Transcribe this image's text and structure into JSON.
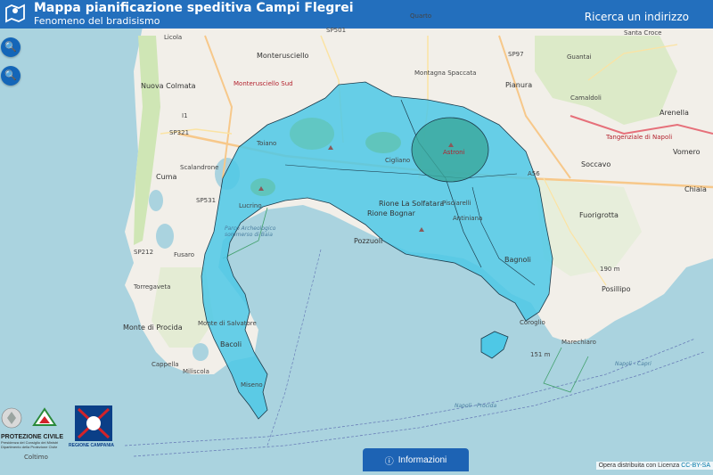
{
  "header": {
    "title": "Mappa pianificazione speditiva Campi Flegrei",
    "subtitle": "Fenomeno del bradisismo",
    "search_label": "Ricerca un indirizzo"
  },
  "colors": {
    "header_bg": "#1866ba",
    "zone_fill": "#4ec8e6",
    "zone_crater": "#3aa89b",
    "sea": "#aad3df",
    "land": "#f2efe9",
    "button": "#1d63b4"
  },
  "zoom": {
    "in_icon": "search-plus-icon",
    "out_icon": "search-minus-icon"
  },
  "map_labels": {
    "quarto": "Quarto",
    "licola": "Licola",
    "monterusciello": "Monterusciello",
    "monterusciello_sud": "Monterusciello Sud",
    "montagna_spaccata": "Montagna Spaccata",
    "pianura": "Pianura",
    "guantai": "Guantai",
    "santa_croce": "Santa Croce",
    "arenella": "Arenella",
    "vomero": "Vomero",
    "camaldoli": "Camaldoli",
    "soccavo": "Soccavo",
    "chiaia": "Chiaia",
    "fuorigrotta": "Fuorigrotta",
    "posillipo": "Posillipo",
    "marechiaro": "Marechiaro",
    "nuova_colmata": "Nuova Colmata",
    "cuma": "Cuma",
    "scalandrone": "Scalandrone",
    "toiano": "Toiano",
    "cigliano": "Cigliano",
    "astroni": "Astroni",
    "rione_solfatara": "Rione La Solfatara",
    "rione_bognar": "Rione Bognar",
    "pisciarelli": "Pisciarelli",
    "antiniana": "Antiniana",
    "pozzuoli": "Pozzuoli",
    "bagnoli": "Bagnoli",
    "coroglio": "Coroglio",
    "lucrino": "Lucrino",
    "fusaro": "Fusaro",
    "torregaveta": "Torregaveta",
    "monte_di_procida": "Monte di Procida",
    "bacoli": "Bacoli",
    "monte_salvatore": "Monte di Salvatore",
    "miliscola": "Miliscola",
    "miseno": "Miseno",
    "cappella": "Cappella",
    "coltimo": "Coltimo",
    "parco_archeologico": "Parco Archeologico sommerso di Baia",
    "sp501": "SP501",
    "sp97": "SP97",
    "sp321": "SP321",
    "sp531": "SP531",
    "sp212": "SP212",
    "a56": "A56",
    "i1": "I1",
    "elev_190": "190 m",
    "elev_151": "151 m",
    "napoli_procida": "Napoli - Procida",
    "napoli_capri": "Napoli - Capri",
    "tangenziale": "Tangenziale di Napoli"
  },
  "logos": {
    "pc_title": "PROTEZIONE CIVILE",
    "pc_sub": "Presidenza del Consiglio dei Ministri Dipartimento della Protezione Civile",
    "rc_title": "REGIONE CAMPANIA"
  },
  "info_button": {
    "label": "Informazioni",
    "icon": "info-circle-icon"
  },
  "attribution": {
    "text": "Opera distribuita con Licenza",
    "link": "CC-BY-SA"
  }
}
